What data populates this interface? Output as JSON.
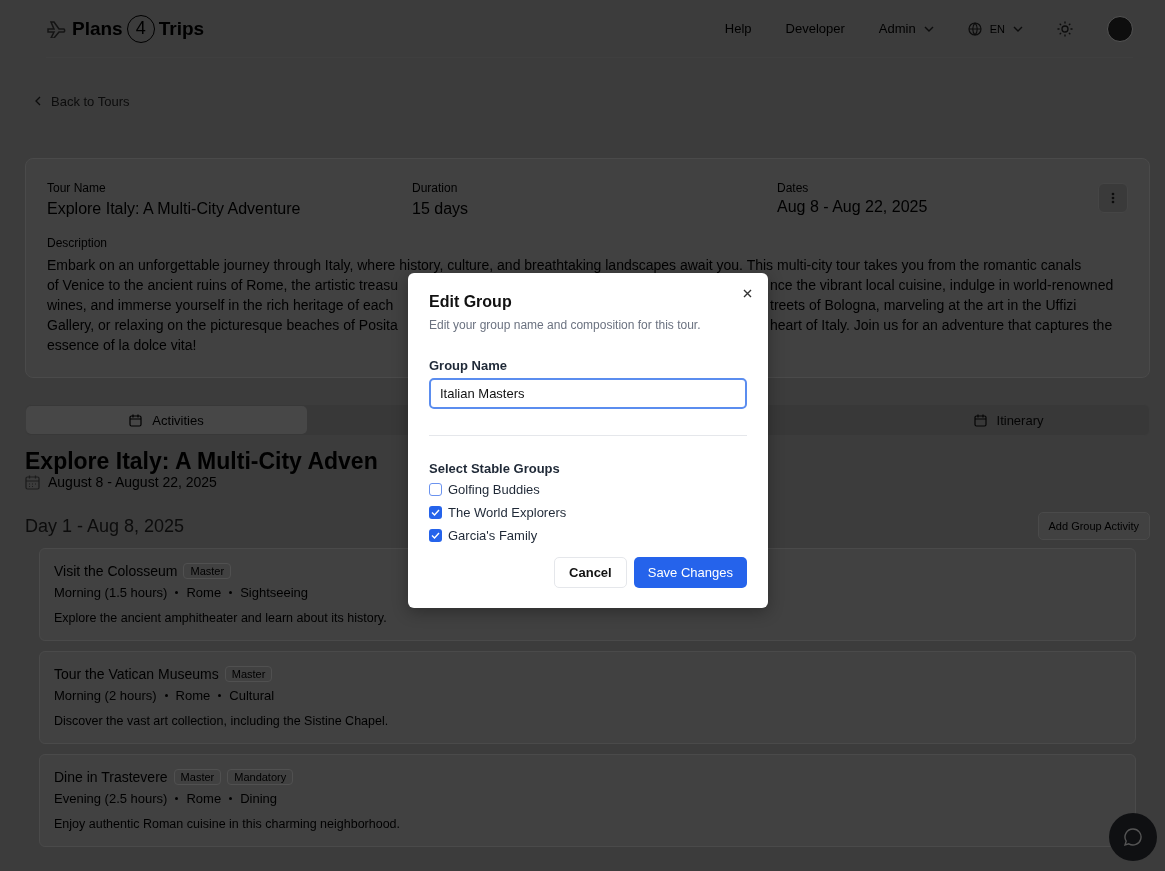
{
  "header": {
    "logo": {
      "left": "Plans",
      "number": "4",
      "right": "Trips"
    },
    "nav": [
      {
        "label": "Help",
        "kind": "link"
      },
      {
        "label": "Developer",
        "kind": "link"
      },
      {
        "label": "Admin",
        "kind": "menu"
      }
    ],
    "language": "EN"
  },
  "back_link": "Back to Tours",
  "tour": {
    "fields": [
      {
        "label": "Tour Name",
        "value": "Explore Italy: A Multi-City Adventure"
      },
      {
        "label": "Duration",
        "value": "15 days"
      },
      {
        "label": "Dates",
        "value": "Aug 8 - Aug 22, 2025"
      }
    ],
    "description_label": "Description",
    "description_lines": [
      {
        "left": "Embark on an unforgettable journey through Italy, where history, culture, and breathtaking landscapes await you. This multi-city tour takes you from the romantic canals"
      },
      {
        "left": "of Venice to the ancient ruins of Rome, the artistic treasu",
        "right": "nce the vibrant local cuisine, indulge in world-renowned"
      },
      {
        "left": "wines, and immerse yourself in the rich heritage of each",
        "right": "treets of Bologna, marveling at the art in the Uffizi"
      },
      {
        "left": "Gallery, or relaxing on the picturesque beaches of Posita",
        "right": "heart of Italy. Join us for an adventure that captures the"
      },
      {
        "left": "essence of la dolce vita!"
      }
    ]
  },
  "tabs": [
    {
      "label": "Activities",
      "selected": true
    },
    {
      "label": "Itinerary",
      "selected": false
    }
  ],
  "heading": "Explore Italy: A Multi-City Adven",
  "date_range": "August 8 - August 22, 2025",
  "day": {
    "title": "Day 1 - Aug 8, 2025",
    "add_button": "Add Group Activity",
    "activities": [
      {
        "title": "Visit the Colosseum",
        "tags": [
          "Master"
        ],
        "time": "Morning (1.5 hours)",
        "city": "Rome",
        "category": "Sightseeing",
        "description": "Explore the ancient amphitheater and learn about its history."
      },
      {
        "title": "Tour the Vatican Museums",
        "tags": [
          "Master"
        ],
        "time": "Morning (2 hours)",
        "city": "Rome",
        "category": "Cultural",
        "description": "Discover the vast art collection, including the Sistine Chapel."
      },
      {
        "title": "Dine in Trastevere",
        "tags": [
          "Master",
          "Mandatory"
        ],
        "time": "Evening (2.5 hours)",
        "city": "Rome",
        "category": "Dining",
        "description": "Enjoy authentic Roman cuisine in this charming neighborhood."
      }
    ]
  },
  "dialog": {
    "title": "Edit Group",
    "subtitle": "Edit your group name and composition for this tour.",
    "name_label": "Group Name",
    "name_value": "Italian Masters",
    "groups_label": "Select Stable Groups",
    "groups": [
      {
        "label": "Golfing Buddies",
        "checked": false
      },
      {
        "label": "The World Explorers",
        "checked": true
      },
      {
        "label": "Garcia's Family",
        "checked": true
      }
    ],
    "cancel": "Cancel",
    "save": "Save Changes"
  }
}
